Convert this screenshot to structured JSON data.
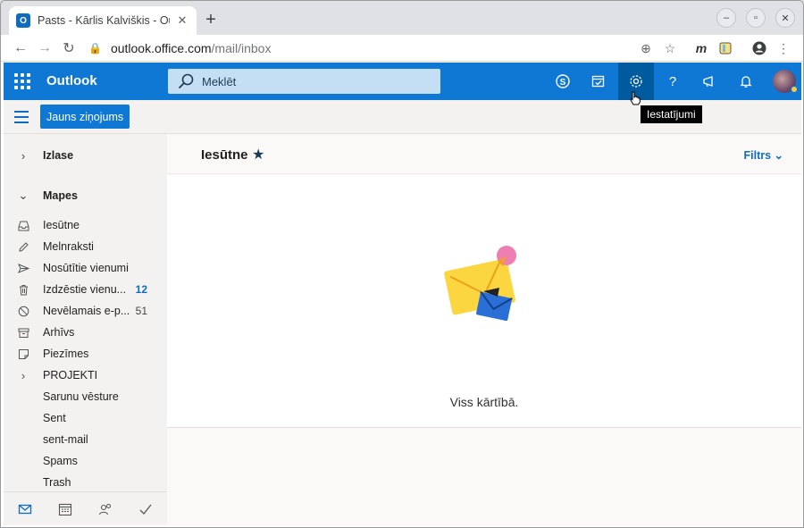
{
  "browser": {
    "tab_title": "Pasts - Kārlis Kalviškis - Outlook",
    "url_host": "outlook.office.com",
    "url_path": "/mail/inbox",
    "ext_label": "m"
  },
  "header": {
    "app_name": "Outlook",
    "search_placeholder": "Meklēt",
    "settings_tooltip": "Iestatījumi",
    "accent": "#0f78d4"
  },
  "command_bar": {
    "new_message_label": "Jauns ziņojums"
  },
  "nav": {
    "favorites_label": "Izlase",
    "folders_label": "Mapes",
    "folders": [
      {
        "name": "Iesūtne",
        "icon": "inbox-icon",
        "count": ""
      },
      {
        "name": "Melnraksti",
        "icon": "pencil-icon",
        "count": ""
      },
      {
        "name": "Nosūtītie vienumi",
        "icon": "send-icon",
        "count": ""
      },
      {
        "name": "Izdzēstie vienu...",
        "icon": "trash-icon",
        "count": "12"
      },
      {
        "name": "Nevēlamais e-p...",
        "icon": "block-icon",
        "count": "51"
      },
      {
        "name": "Arhīvs",
        "icon": "archive-icon",
        "count": ""
      },
      {
        "name": "Piezīmes",
        "icon": "note-icon",
        "count": ""
      },
      {
        "name": "PROJEKTI",
        "icon": "chevron-right-icon",
        "count": ""
      },
      {
        "name": "Sarunu vēsture",
        "icon": "",
        "count": ""
      },
      {
        "name": "Sent",
        "icon": "",
        "count": ""
      },
      {
        "name": "sent-mail",
        "icon": "",
        "count": ""
      },
      {
        "name": "Spams",
        "icon": "",
        "count": ""
      },
      {
        "name": "Trash",
        "icon": "",
        "count": ""
      }
    ]
  },
  "main": {
    "title": "Iesūtne",
    "filter_label": "Filtrs",
    "empty_message": "Viss kārtībā."
  }
}
